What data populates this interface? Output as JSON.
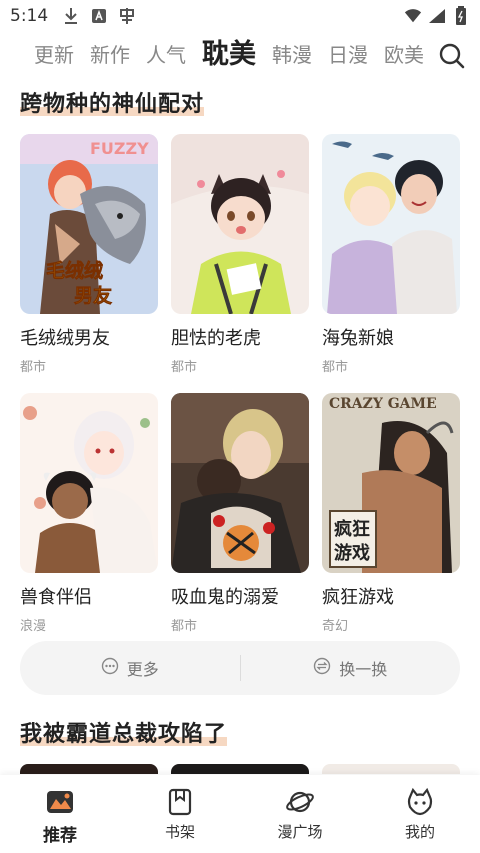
{
  "status_bar": {
    "time": "5:14",
    "left_icons": [
      "download-icon",
      "app-a-icon",
      "app-logo-icon"
    ],
    "right_icons": [
      "wifi-icon",
      "signal-icon",
      "battery-icon"
    ]
  },
  "top_tabs": [
    {
      "label": "更新",
      "active": false
    },
    {
      "label": "新作",
      "active": false
    },
    {
      "label": "人气",
      "active": false
    },
    {
      "label": "耽美",
      "active": true
    },
    {
      "label": "韩漫",
      "active": false
    },
    {
      "label": "日漫",
      "active": false
    },
    {
      "label": "欧美",
      "active": false
    }
  ],
  "section1": {
    "title": "跨物种的神仙配对",
    "cards": [
      {
        "title": "毛绒绒男友",
        "genre": "都市",
        "cover_text": "毛绒绒男友"
      },
      {
        "title": "胆怯的老虎",
        "genre": "都市"
      },
      {
        "title": "海兔新娘",
        "genre": "都市"
      },
      {
        "title": "兽食伴侣",
        "genre": "浪漫"
      },
      {
        "title": "吸血鬼的溺爱",
        "genre": "都市"
      },
      {
        "title": "疯狂游戏",
        "genre": "奇幻",
        "cover_text": "CRAZY GAME"
      }
    ]
  },
  "actions": {
    "more_label": "更多",
    "refresh_label": "换一换"
  },
  "section2": {
    "title": "我被霸道总裁攻陷了"
  },
  "bottom_nav": [
    {
      "label": "推荐",
      "icon": "recommend-icon",
      "active": true
    },
    {
      "label": "书架",
      "icon": "bookshelf-icon",
      "active": false
    },
    {
      "label": "漫广场",
      "icon": "planet-icon",
      "active": false
    },
    {
      "label": "我的",
      "icon": "profile-icon",
      "active": false
    }
  ],
  "colors": {
    "accent": "#f6d8c2",
    "text_primary": "#222222",
    "text_secondary": "#999999"
  }
}
